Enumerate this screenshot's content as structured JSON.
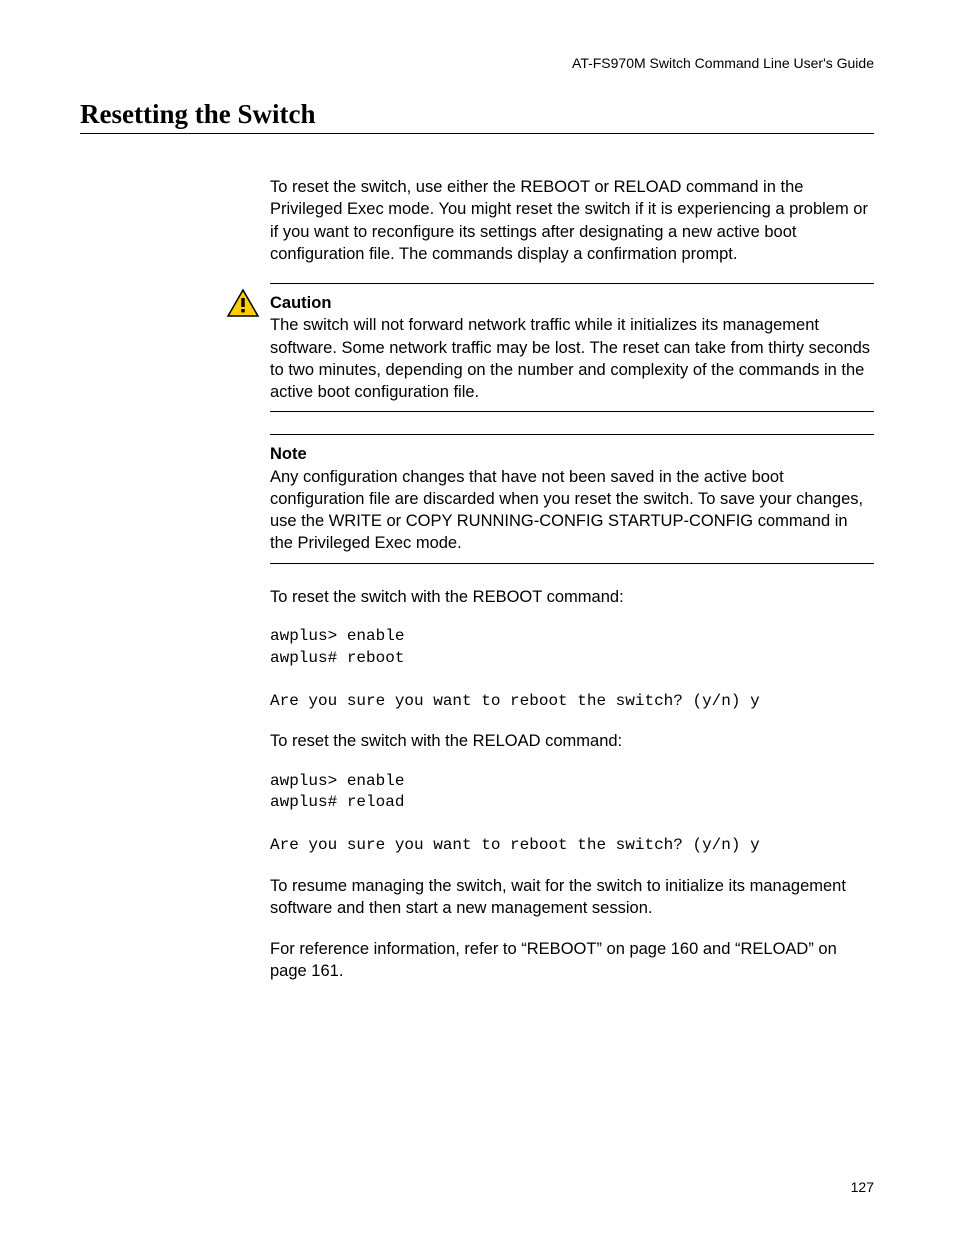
{
  "header": {
    "running_head": "AT-FS970M Switch Command Line User's Guide"
  },
  "section": {
    "title": "Resetting the Switch"
  },
  "paragraphs": {
    "intro": "To reset the switch, use either the REBOOT or RELOAD command in the Privileged Exec mode. You might reset the switch if it is experiencing a problem or if you want to reconfigure its settings after designating a new active boot configuration file. The commands display a confirmation prompt.",
    "reboot_lead": "To reset the switch with the REBOOT command:",
    "reload_lead": "To reset the switch with the RELOAD command:",
    "resume": "To resume managing the switch, wait for the switch to initialize its management software and then start a new management session.",
    "reference": "For reference information, refer to “REBOOT” on page 160 and “RELOAD” on page 161."
  },
  "admonitions": {
    "caution": {
      "title": "Caution",
      "body": "The switch will not forward network traffic while it initializes its management software. Some network traffic may be lost. The reset can take from thirty seconds to two minutes, depending on the number and complexity of the commands in the active boot configuration file."
    },
    "note": {
      "title": "Note",
      "body": "Any configuration changes that have not been saved in the active boot configuration file are discarded when you reset the switch. To save your changes, use the WRITE or COPY RUNNING-CONFIG STARTUP-CONFIG command in the Privileged Exec mode."
    }
  },
  "code": {
    "reboot": "awplus> enable\nawplus# reboot\n\nAre you sure you want to reboot the switch? (y/n) y",
    "reload": "awplus> enable\nawplus# reload\n\nAre you sure you want to reboot the switch? (y/n) y"
  },
  "footer": {
    "page_number": "127"
  }
}
